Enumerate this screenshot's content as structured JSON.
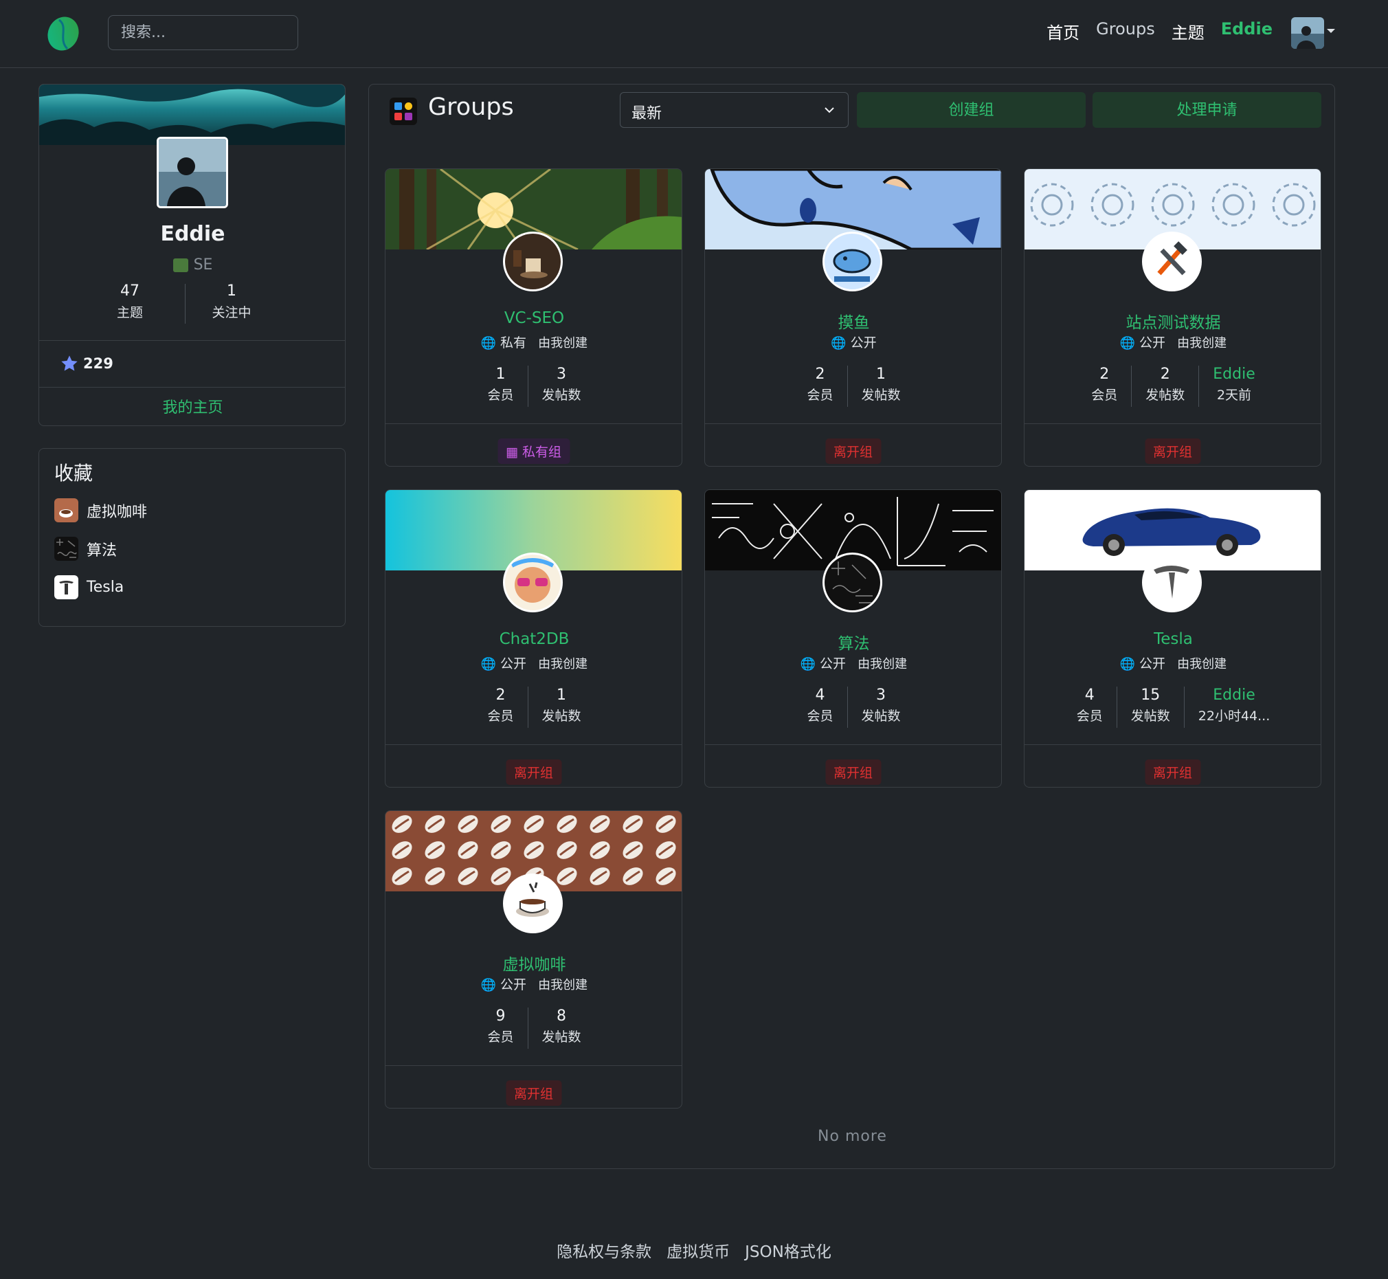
{
  "nav": {
    "search_placeholder": "搜索...",
    "links": [
      "首页",
      "Groups",
      "主题",
      "Eddie"
    ]
  },
  "profile": {
    "name": "Eddie",
    "role": "SE",
    "topics_count": "47",
    "topics_label": "主题",
    "following_count": "1",
    "following_label": "关注中",
    "score": "229",
    "home_link": "我的主页"
  },
  "favorites": {
    "title": "收藏",
    "items": [
      "虚拟咖啡",
      "算法",
      "Tesla"
    ]
  },
  "groups": {
    "title": "Groups",
    "sort_selected": "最新",
    "create_button": "创建组",
    "requests_button": "处理申请",
    "members_label": "会员",
    "posts_label": "发帖数",
    "no_more": "No more",
    "cards": [
      {
        "name": "VC-SEO",
        "visibility": "私有",
        "owner": "由我创建",
        "members": "1",
        "posts": "3",
        "last_user": "",
        "last_time": "",
        "action": "私有组"
      },
      {
        "name": "摸鱼",
        "visibility": "公开",
        "owner": "",
        "members": "2",
        "posts": "1",
        "last_user": "",
        "last_time": "",
        "action": "离开组"
      },
      {
        "name": "站点测试数据",
        "visibility": "公开",
        "owner": "由我创建",
        "members": "2",
        "posts": "2",
        "last_user": "Eddie",
        "last_time": "2天前",
        "action": "离开组"
      },
      {
        "name": "Chat2DB",
        "visibility": "公开",
        "owner": "由我创建",
        "members": "2",
        "posts": "1",
        "last_user": "",
        "last_time": "",
        "action": "离开组"
      },
      {
        "name": "算法",
        "visibility": "公开",
        "owner": "由我创建",
        "members": "4",
        "posts": "3",
        "last_user": "",
        "last_time": "",
        "action": "离开组"
      },
      {
        "name": "Tesla",
        "visibility": "公开",
        "owner": "由我创建",
        "members": "4",
        "posts": "15",
        "last_user": "Eddie",
        "last_time": "22小时44...",
        "action": "离开组"
      },
      {
        "name": "虚拟咖啡",
        "visibility": "公开",
        "owner": "由我创建",
        "members": "9",
        "posts": "8",
        "last_user": "",
        "last_time": "",
        "action": "离开组"
      }
    ]
  },
  "footer": {
    "links": [
      "隐私权与条款",
      "虚拟货币",
      "JSON格式化"
    ]
  },
  "colors": {
    "background": "#212529",
    "accent_green": "#2fbf71",
    "leave_red": "#e03131",
    "private_purple": "#cc5de8"
  }
}
